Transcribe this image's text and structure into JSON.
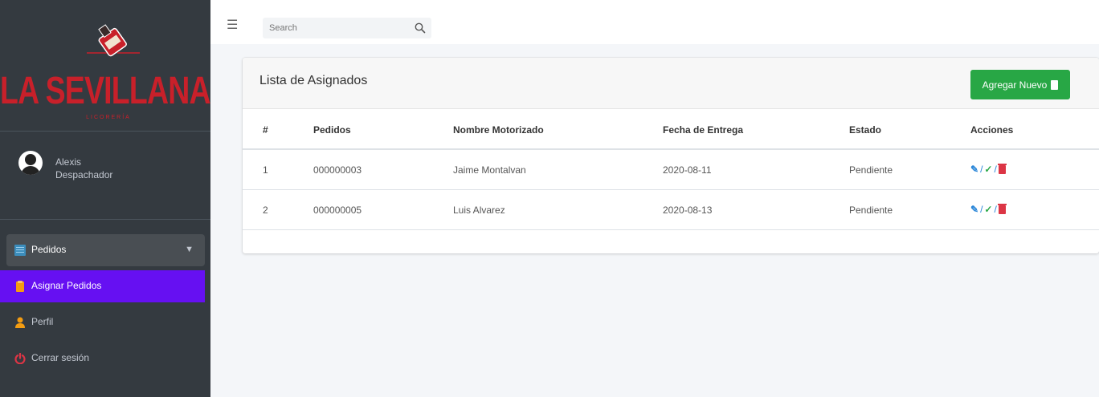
{
  "brand": {
    "title": "LA SEVILLANA",
    "subtitle": "LICORERÍA"
  },
  "user": {
    "name": "Alexis",
    "role": "Despachador"
  },
  "sidebar": {
    "items": [
      {
        "label": "Pedidos",
        "icon": "table-icon",
        "color": "#3c8dbc"
      },
      {
        "label": "Asignar Pedidos",
        "icon": "clipboard-icon",
        "color": "#f39c12"
      },
      {
        "label": "Perfil",
        "icon": "user-icon",
        "color": "#f39c12"
      },
      {
        "label": "Cerrar sesión",
        "icon": "power-icon",
        "color": "#dc3545"
      }
    ]
  },
  "search": {
    "placeholder": "Search"
  },
  "card": {
    "title": "Lista de Asignados",
    "add_button": "Agregar Nuevo"
  },
  "table": {
    "headers": [
      "#",
      "Pedidos",
      "Nombre Motorizado",
      "Fecha de Entrega",
      "Estado",
      "Acciones"
    ],
    "rows": [
      {
        "num": "1",
        "pedido": "000000003",
        "motorizado": "Jaime Montalvan",
        "fecha": "2020-08-11",
        "estado": "Pendiente"
      },
      {
        "num": "2",
        "pedido": "000000005",
        "motorizado": "Luis Alvarez",
        "fecha": "2020-08-13",
        "estado": "Pendiente"
      }
    ]
  },
  "colors": {
    "accent": "#6610f2",
    "success": "#28a745",
    "danger": "#dc3545",
    "sidebar_bg": "#343a40",
    "brand_red": "#c8202a"
  }
}
